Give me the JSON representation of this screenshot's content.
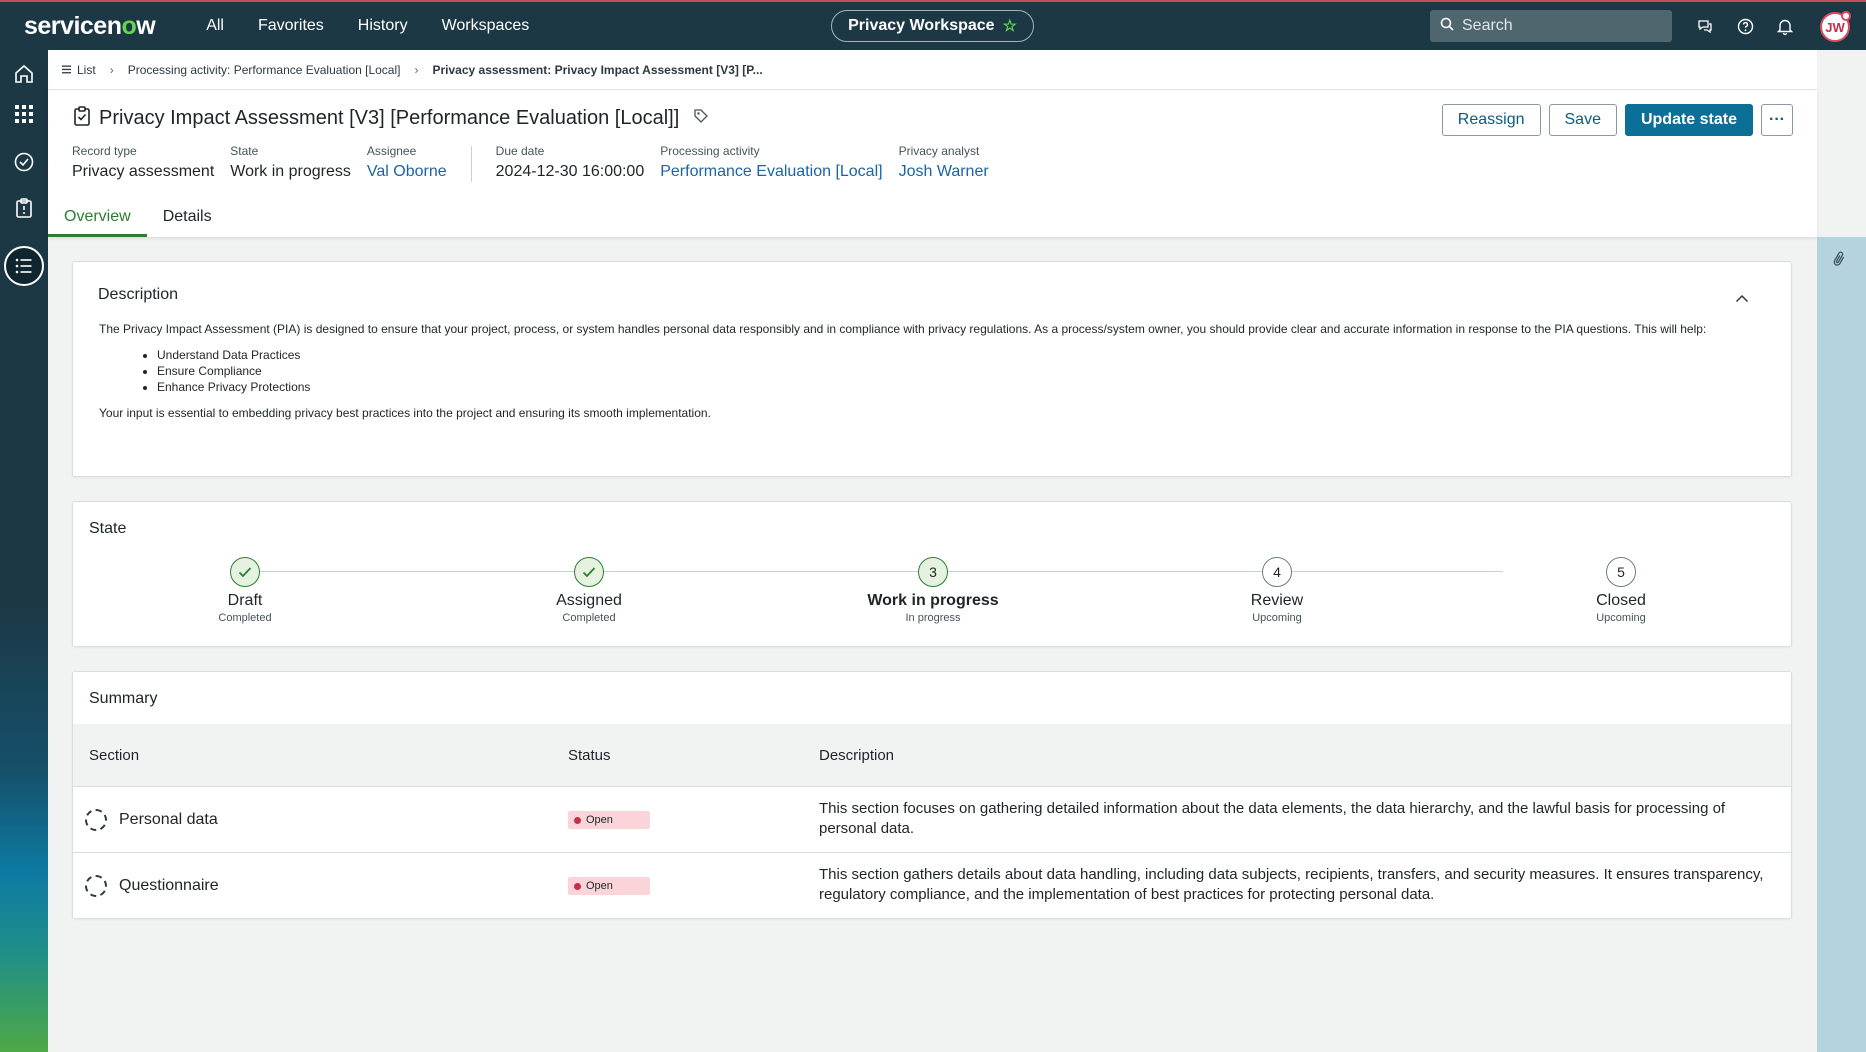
{
  "topnav": {
    "logo_prefix": "servicen",
    "logo_o": "o",
    "logo_suffix": "w",
    "menu": [
      "All",
      "Favorites",
      "History",
      "Workspaces"
    ],
    "workspace": "Privacy Workspace",
    "search_placeholder": "Search",
    "avatar_initials": "JW"
  },
  "breadcrumb": {
    "list": "List",
    "processing": "Processing activity: Performance Evaluation [Local]",
    "current": "Privacy assessment: Privacy Impact Assessment [V3] [P..."
  },
  "record": {
    "title": "Privacy Impact Assessment [V3] [Performance Evaluation [Local]]",
    "actions": {
      "reassign": "Reassign",
      "save": "Save",
      "update": "Update state",
      "more": "···"
    },
    "fields": [
      {
        "label": "Record type",
        "value": "Privacy assessment"
      },
      {
        "label": "State",
        "value": "Work in progress"
      },
      {
        "label": "Assignee",
        "value": "Val Oborne"
      },
      {
        "label": "Due date",
        "value": "2024-12-30 16:00:00"
      },
      {
        "label": "Processing activity",
        "value": "Performance Evaluation [Local]"
      },
      {
        "label": "Privacy analyst",
        "value": "Josh Warner"
      }
    ],
    "tabs": [
      "Overview",
      "Details"
    ]
  },
  "description": {
    "title": "Description",
    "intro": "The Privacy Impact Assessment (PIA) is designed to ensure that your project, process, or system handles personal data responsibly and in compliance with privacy regulations. As a process/system owner, you should provide clear and accurate information in response to the PIA questions. This will help:",
    "bullets": [
      "Understand Data Practices",
      "Ensure Compliance",
      "Enhance Privacy Protections"
    ],
    "outro": "Your input is essential to embedding privacy best practices into the project and ensuring its smooth implementation."
  },
  "state": {
    "title": "State",
    "steps": [
      {
        "label": "Draft",
        "sub": "Completed",
        "number": ""
      },
      {
        "label": "Assigned",
        "sub": "Completed",
        "number": ""
      },
      {
        "label": "Work in progress",
        "sub": "In progress",
        "number": "3"
      },
      {
        "label": "Review",
        "sub": "Upcoming",
        "number": "4"
      },
      {
        "label": "Closed",
        "sub": "Upcoming",
        "number": "5"
      }
    ]
  },
  "summary": {
    "title": "Summary",
    "headers": {
      "section": "Section",
      "status": "Status",
      "description": "Description"
    },
    "rows": [
      {
        "section": "Personal data",
        "status": "Open",
        "description": "This section focuses on gathering detailed information about the data elements, the data hierarchy, and the lawful basis for processing of personal data."
      },
      {
        "section": "Questionnaire",
        "status": "Open",
        "description": "This section gathers details about data handling, including data subjects, recipients, transfers, and security measures. It ensures transparency, regulatory compliance, and the implementation of best practices for protecting personal data."
      }
    ]
  },
  "colors": {
    "topnav": "#1c3845",
    "accent_green": "#2e7d32",
    "primary_button": "#0c6f97",
    "link": "#1a64a8",
    "badge_open_bg": "#fbd4d9"
  }
}
